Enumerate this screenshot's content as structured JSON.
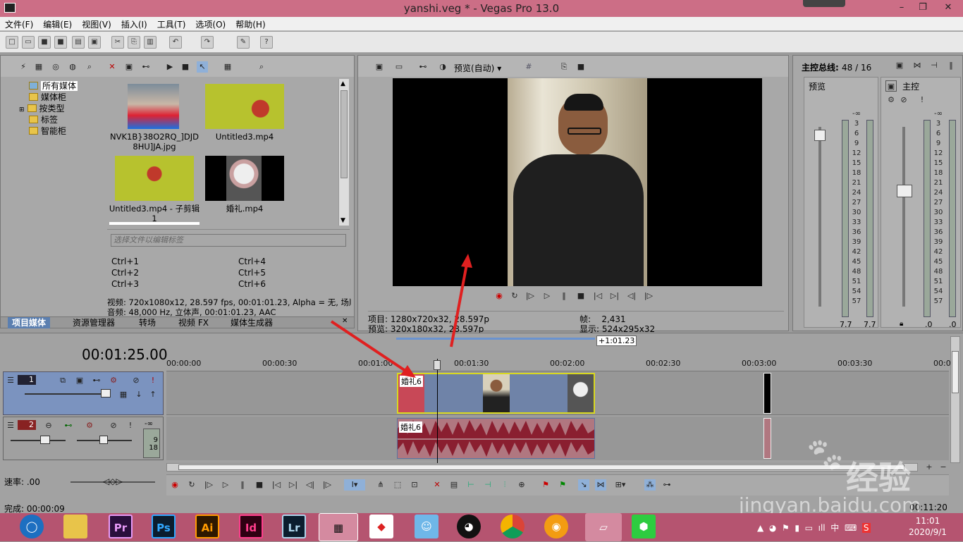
{
  "window": {
    "title": "yanshi.veg * - Vegas Pro 13.0"
  },
  "menu": [
    "文件(F)",
    "编辑(E)",
    "视图(V)",
    "插入(I)",
    "工具(T)",
    "选项(O)",
    "帮助(H)"
  ],
  "media": {
    "tree": [
      "所有媒体",
      "媒体柜",
      "按类型",
      "标签",
      "智能柜"
    ],
    "thumbs": [
      {
        "caption": "NVK1B}38O2RQ_]DJD8HU]JA.jpg"
      },
      {
        "caption": "Untitled3.mp4"
      },
      {
        "caption": "Untitled3.mp4 - 子剪辑 1"
      },
      {
        "caption": "婚礼.mp4"
      }
    ],
    "tag_placeholder": "选择文件以编辑标签",
    "shortcuts": [
      "Ctrl+1",
      "Ctrl+2",
      "Ctrl+3",
      "Ctrl+4",
      "Ctrl+5",
      "Ctrl+6"
    ],
    "video_info": "视频: 720x1080x12, 28.597 fps, 00:01:01.23, Alpha = 无, 场顺",
    "audio_info": "音频: 48,000 Hz, 立体声, 00:01:01.23, AAC",
    "tabs": [
      "项目媒体",
      "资源管理器",
      "转场",
      "视频 FX",
      "媒体生成器"
    ]
  },
  "preview": {
    "mode": "预览(自动)",
    "project_label": "项目:",
    "project_value": "1280x720x32, 28.597p",
    "preview_label": "预览:",
    "preview_value": "320x180x32, 28.597p",
    "frame_label": "帧:",
    "frame_value": "2,431",
    "display_label": "显示:",
    "display_value": "524x295x32"
  },
  "mixer": {
    "title": "主控总线:",
    "counts": "48 / 16",
    "preview_label": "预览",
    "master_label": "主控",
    "scale": [
      "-∞",
      "3",
      "6",
      "9",
      "12",
      "15",
      "18",
      "21",
      "24",
      "27",
      "30",
      "33",
      "36",
      "39",
      "42",
      "45",
      "48",
      "51",
      "54",
      "57"
    ],
    "peak_left": "7.7",
    "peak_right": "7.7",
    "master_peak_left": ".0",
    "master_peak_right": ".0"
  },
  "timeline": {
    "timecode": "00:01:25.00",
    "loop_label": "+1:01.23",
    "ruler": [
      "00:00:00",
      "00:00:30",
      "00:01:00",
      "00:01:30",
      "00:02:00",
      "00:02:30",
      "00:03:00",
      "00:03:30",
      "00:0"
    ],
    "track1_num": "1",
    "track2_num": "2",
    "track2_vol": "-∞",
    "track2_meter_a": "9",
    "track2_meter_b": "18",
    "clip_video": "婚礼6",
    "clip_audio": "婚礼6",
    "rate": "速率: .00",
    "status": "完成: 00:00:09",
    "status_right": "00:11:20"
  },
  "taskbar": {
    "icons": [
      "Pr",
      "Ps",
      "Ai",
      "Id",
      "Lr"
    ],
    "time": "11:01",
    "date": "2020/9/1",
    "ime": "中"
  },
  "watermark": {
    "url": "jingyan.baidu.com",
    "brand": "经验"
  },
  "colors": {
    "title_bar": "#cc6e86",
    "taskbar": "#b55470",
    "video_track": "#7b93bf",
    "audio_clip": "#8a1f30",
    "clip_selected": "#d8d820"
  }
}
